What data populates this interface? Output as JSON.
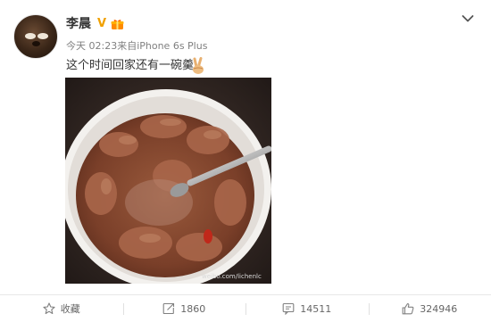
{
  "post": {
    "username": "李晨",
    "verified_badge": "V",
    "meta": "今天 02:23来自iPhone 6s Plus",
    "text": "这个时间回家还有一碗羹",
    "image_watermark": "weibo.com/lichenlc"
  },
  "icons": {
    "menu": "chevron-down-icon",
    "membership": "gift-badge-icon",
    "emoji": "victory-hand-icon",
    "favorite": "star-icon",
    "repost": "repost-icon",
    "comment": "comment-icon",
    "like": "thumbs-up-icon"
  },
  "actions": {
    "favorite_label": "收藏",
    "repost_count": "1860",
    "comment_count": "14511",
    "like_count": "324946"
  },
  "colors": {
    "verified": "#f0a000",
    "text": "#333333",
    "meta": "#808080",
    "divider": "#e8e8e8"
  }
}
